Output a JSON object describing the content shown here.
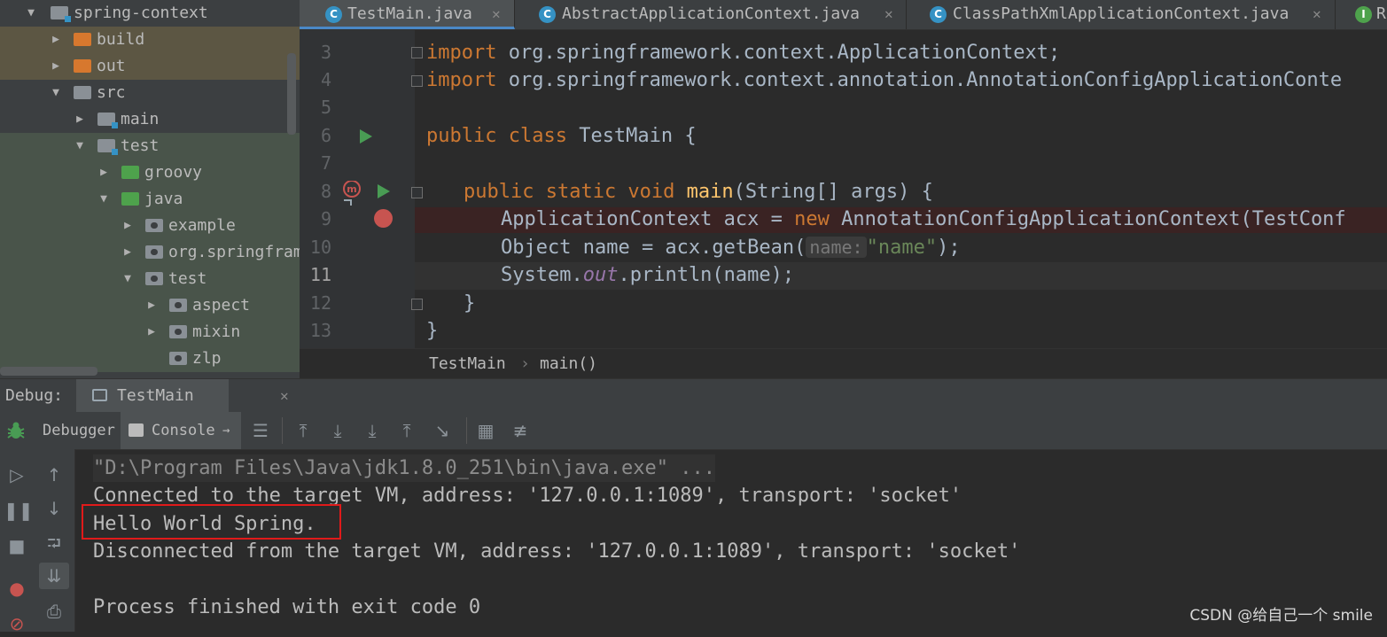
{
  "project_tree": {
    "items": [
      {
        "label": "spring-context",
        "indent": 0,
        "expanded": true,
        "icon": "module-folder"
      },
      {
        "label": "build",
        "indent": 1,
        "expanded": false,
        "icon": "excluded-folder"
      },
      {
        "label": "out",
        "indent": 1,
        "expanded": false,
        "icon": "excluded-folder"
      },
      {
        "label": "src",
        "indent": 1,
        "expanded": true,
        "icon": "folder"
      },
      {
        "label": "main",
        "indent": 2,
        "expanded": false,
        "icon": "source-folder"
      },
      {
        "label": "test",
        "indent": 2,
        "expanded": true,
        "icon": "source-folder"
      },
      {
        "label": "groovy",
        "indent": 3,
        "expanded": false,
        "icon": "test-folder"
      },
      {
        "label": "java",
        "indent": 3,
        "expanded": true,
        "icon": "test-folder"
      },
      {
        "label": "example",
        "indent": 4,
        "expanded": false,
        "icon": "package"
      },
      {
        "label": "org.springframew",
        "indent": 4,
        "expanded": false,
        "icon": "package"
      },
      {
        "label": "test",
        "indent": 4,
        "expanded": true,
        "icon": "package"
      },
      {
        "label": "aspect",
        "indent": 5,
        "expanded": false,
        "icon": "package"
      },
      {
        "label": "mixin",
        "indent": 5,
        "expanded": false,
        "icon": "package"
      },
      {
        "label": "zlp",
        "indent": 5,
        "expanded": null,
        "icon": "package"
      }
    ]
  },
  "editor_tabs": [
    {
      "label": "TestMain.java",
      "active": true,
      "icon": "class-icon"
    },
    {
      "label": "AbstractApplicationContext.java",
      "active": false,
      "icon": "abstract-class-icon"
    },
    {
      "label": "ClassPathXmlApplicationContext.java",
      "active": false,
      "icon": "class-icon"
    },
    {
      "label": "R",
      "active": false,
      "icon": "interface-icon"
    }
  ],
  "code": {
    "line_numbers": [
      "3",
      "4",
      "5",
      "6",
      "7",
      "8",
      "9",
      "10",
      "11",
      "12",
      "13"
    ],
    "current_line": "11",
    "line3": {
      "kw": "import",
      "rest": " org.springframework.context.ApplicationContext;"
    },
    "line4": {
      "kw": "import",
      "rest": " org.springframework.context.annotation.AnnotationConfigApplicationConte"
    },
    "line6": {
      "kw": "public class",
      "rest": " TestMain {"
    },
    "line8": {
      "kw": "public static void",
      "fn": " main",
      "rest": "(String[] args) {"
    },
    "line9": {
      "rest1": "ApplicationContext acx = ",
      "kw": "new",
      "rest2": " AnnotationConfigApplicationContext(TestConf"
    },
    "line10": {
      "rest1": "Object name = acx.getBean(",
      "hint": "name:",
      "str": "\"name\"",
      "rest2": ");"
    },
    "line11": {
      "rest1": "System.",
      "stat": "out",
      "rest2": ".println(name);"
    },
    "line12": {
      "rest": "}"
    },
    "line13": {
      "rest": "}"
    }
  },
  "breadcrumb": {
    "class": "TestMain",
    "sep": "›",
    "method": "main()"
  },
  "debug": {
    "title": "Debug:",
    "session_tab": "TestMain",
    "tabs": {
      "debugger": "Debugger",
      "console": "Console"
    }
  },
  "console": {
    "lines": [
      "\"D:\\Program Files\\Java\\jdk1.8.0_251\\bin\\java.exe\" ...",
      "Connected to the target VM, address: '127.0.0.1:1089', transport: 'socket'",
      "Hello World Spring.",
      "Disconnected from the target VM, address: '127.0.0.1:1089', transport: 'socket'",
      "",
      "Process finished with exit code 0"
    ]
  },
  "watermark": "CSDN @给自己一个 smile"
}
